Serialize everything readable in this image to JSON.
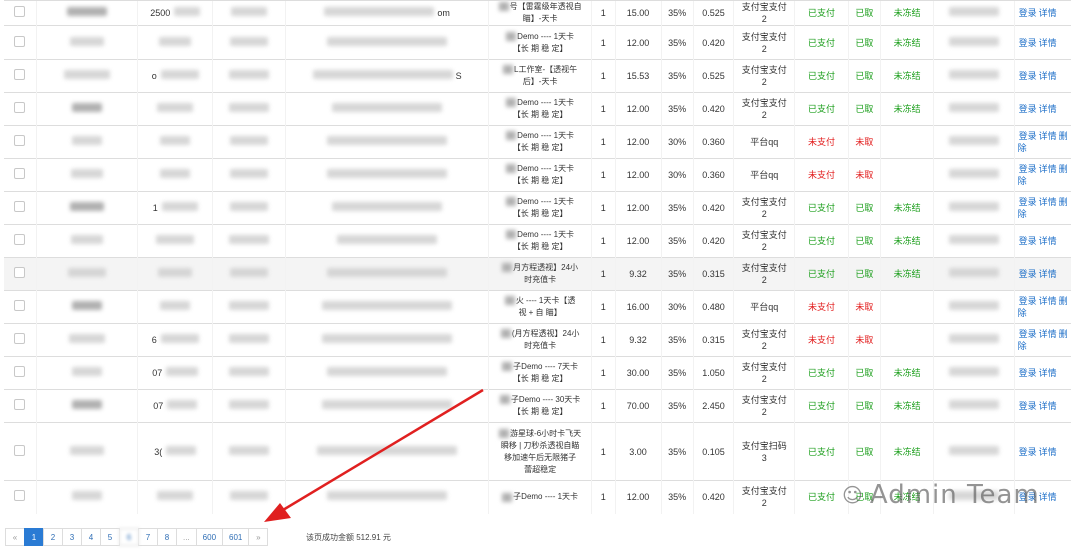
{
  "colors": {
    "paid": "#1b9e1b",
    "unpaid": "#e21b1b",
    "link": "#1e6fc8",
    "accent": "#2a7bd4",
    "arrow": "#e02020"
  },
  "ops": {
    "login": "登录",
    "detail": "详情",
    "delete": "删除"
  },
  "rows": [
    {
      "h": 21,
      "prod1": "号【雷霆级年透视自",
      "prod2": "瞄】-天卡",
      "qty": "1",
      "price": "15.00",
      "rate": "35%",
      "comm": "0.525",
      "pay1": "支付宝支付",
      "pay2": "2",
      "status": "已支付",
      "taken": "已取",
      "frozen": "未冻结",
      "del": false,
      "hl": false,
      "extra": "2500",
      "extra2": "om"
    },
    {
      "h": 34,
      "prod1": "Demo ---- 1天卡",
      "prod2": "【长 期 稳 定】",
      "qty": "1",
      "price": "12.00",
      "rate": "35%",
      "comm": "0.420",
      "pay1": "支付宝支付",
      "pay2": "2",
      "status": "已支付",
      "taken": "已取",
      "frozen": "未冻结",
      "del": false,
      "hl": false
    },
    {
      "h": 33,
      "prod1": "L工作室-【透视午",
      "prod2": "后】-天卡",
      "qty": "1",
      "price": "15.53",
      "rate": "35%",
      "comm": "0.525",
      "pay1": "支付宝支付",
      "pay2": "2",
      "status": "已支付",
      "taken": "已取",
      "frozen": "未冻结",
      "del": false,
      "hl": false,
      "extra": "o",
      "extra2": "S"
    },
    {
      "h": 33,
      "prod1": "Demo ---- 1天卡",
      "prod2": "【长 期 稳 定】",
      "qty": "1",
      "price": "12.00",
      "rate": "35%",
      "comm": "0.420",
      "pay1": "支付宝支付",
      "pay2": "2",
      "status": "已支付",
      "taken": "已取",
      "frozen": "未冻结",
      "del": false,
      "hl": false
    },
    {
      "h": 33,
      "prod1": "Demo ---- 1天卡",
      "prod2": "【长 期 稳 定】",
      "qty": "1",
      "price": "12.00",
      "rate": "30%",
      "comm": "0.360",
      "pay1": "平台qq",
      "pay2": "",
      "status": "未支付",
      "taken": "未取",
      "frozen": "",
      "del": true,
      "hl": false
    },
    {
      "h": 33,
      "prod1": "Demo ---- 1天卡",
      "prod2": "【长 期 稳 定】",
      "qty": "1",
      "price": "12.00",
      "rate": "30%",
      "comm": "0.360",
      "pay1": "平台qq",
      "pay2": "",
      "status": "未支付",
      "taken": "未取",
      "frozen": "",
      "del": true,
      "hl": false
    },
    {
      "h": 33,
      "prod1": "Demo ---- 1天卡",
      "prod2": "【长 期 稳 定】",
      "qty": "1",
      "price": "12.00",
      "rate": "35%",
      "comm": "0.420",
      "pay1": "支付宝支付",
      "pay2": "2",
      "status": "已支付",
      "taken": "已取",
      "frozen": "未冻结",
      "del": true,
      "hl": false,
      "extra": "1"
    },
    {
      "h": 33,
      "prod1": "Demo ---- 1天卡",
      "prod2": "【长 期 稳 定】",
      "qty": "1",
      "price": "12.00",
      "rate": "35%",
      "comm": "0.420",
      "pay1": "支付宝支付",
      "pay2": "2",
      "status": "已支付",
      "taken": "已取",
      "frozen": "未冻结",
      "del": false,
      "hl": false
    },
    {
      "h": 33,
      "prod1": "月方程透视】24小",
      "prod2": "时充值卡",
      "qty": "1",
      "price": "9.32",
      "rate": "35%",
      "comm": "0.315",
      "pay1": "支付宝支付",
      "pay2": "2",
      "status": "已支付",
      "taken": "已取",
      "frozen": "未冻结",
      "del": false,
      "hl": true
    },
    {
      "h": 33,
      "prod1": "火 ---- 1天卡【透",
      "prod2": "视 + 自 瞄】",
      "qty": "1",
      "price": "16.00",
      "rate": "30%",
      "comm": "0.480",
      "pay1": "平台qq",
      "pay2": "",
      "status": "未支付",
      "taken": "未取",
      "frozen": "",
      "del": true,
      "hl": false
    },
    {
      "h": 33,
      "prod1": "(月方程透视】24小",
      "prod2": "时充值卡",
      "qty": "1",
      "price": "9.32",
      "rate": "35%",
      "comm": "0.315",
      "pay1": "支付宝支付",
      "pay2": "2",
      "status": "未支付",
      "taken": "未取",
      "frozen": "",
      "del": true,
      "hl": false,
      "extra": "6"
    },
    {
      "h": 33,
      "prod1": "子Demo ---- 7天卡",
      "prod2": "【长 期 稳 定】",
      "qty": "1",
      "price": "30.00",
      "rate": "35%",
      "comm": "1.050",
      "pay1": "支付宝支付",
      "pay2": "2",
      "status": "已支付",
      "taken": "已取",
      "frozen": "未冻结",
      "del": false,
      "hl": false,
      "extra": "07"
    },
    {
      "h": 33,
      "prod1": "子Demo ---- 30天卡",
      "prod2": "【长 期 稳 定】",
      "qty": "1",
      "price": "70.00",
      "rate": "35%",
      "comm": "2.450",
      "pay1": "支付宝支付",
      "pay2": "2",
      "status": "已支付",
      "taken": "已取",
      "frozen": "未冻结",
      "del": false,
      "hl": false,
      "extra": "07"
    },
    {
      "h": 58,
      "prod1": "游星球-6小时卡飞天",
      "prod2": "瞬移 | 刀秒杀透视自瞄",
      "prod3": "移加速午后无限猪子",
      "prod4": "蕾超稳定",
      "qty": "1",
      "price": "3.00",
      "rate": "35%",
      "comm": "0.105",
      "pay1": "支付宝扫码",
      "pay2": "3",
      "status": "已支付",
      "taken": "已取",
      "frozen": "未冻结",
      "del": false,
      "hl": false,
      "extra": "3("
    },
    {
      "h": 33,
      "prod1": "子Demo ---- 1天卡",
      "prod2": "",
      "qty": "1",
      "price": "12.00",
      "rate": "35%",
      "comm": "0.420",
      "pay1": "支付宝支付",
      "pay2": "2",
      "status": "已支付",
      "taken": "已取",
      "frozen": "未冻结",
      "del": false,
      "hl": false
    }
  ],
  "pagination": {
    "prev": "«",
    "pages": [
      "1",
      "2",
      "3",
      "4",
      "5",
      "6",
      "7",
      "8",
      "...",
      "600",
      "601"
    ],
    "next": "»",
    "active": "1"
  },
  "total_text": "该页成功金额 512.91 元",
  "watermark": {
    "icon": "wechat-icon",
    "text": "Admin Team"
  }
}
